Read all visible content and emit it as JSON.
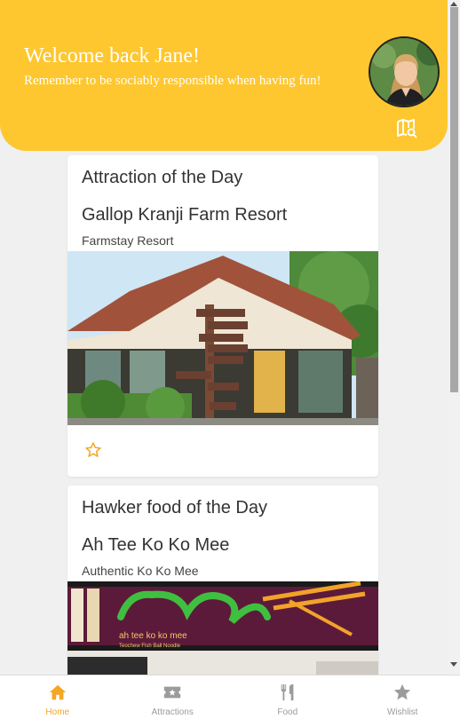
{
  "header": {
    "welcome": "Welcome back Jane!",
    "subtitle": "Remember to be sociably responsible when having fun!",
    "map_icon": "map-search-icon",
    "background": "#fec72f"
  },
  "attraction_card": {
    "title": "Attraction of the Day",
    "name": "Gallop Kranji Farm Resort",
    "type": "Farmstay Resort",
    "favorite_icon": "star-outline-icon",
    "sign_labels": [
      "BROWSER MUSEUM",
      "F&B / SHOPS",
      "THE ACTIVITY",
      "VEG. FARMS",
      "PRAWNING",
      "MAIN OFFICE",
      "BBQ PITS",
      "BUS STOP"
    ]
  },
  "food_card": {
    "title": "Hawker food of the Day",
    "name": "Ah Tee Ko Ko Mee",
    "type": "Authentic Ko Ko Mee",
    "sign_text": "ah tee ko ko mee",
    "sign_subtext": "Teochew Fish Ball Noodle"
  },
  "bottom_nav": [
    {
      "label": "Home",
      "icon": "home-icon",
      "active": true
    },
    {
      "label": "Attractions",
      "icon": "ticket-icon",
      "active": false
    },
    {
      "label": "Food",
      "icon": "utensils-icon",
      "active": false
    },
    {
      "label": "Wishlist",
      "icon": "star-icon",
      "active": false
    }
  ],
  "colors": {
    "accent": "#f5a623",
    "inactive": "#9b9b9b"
  }
}
